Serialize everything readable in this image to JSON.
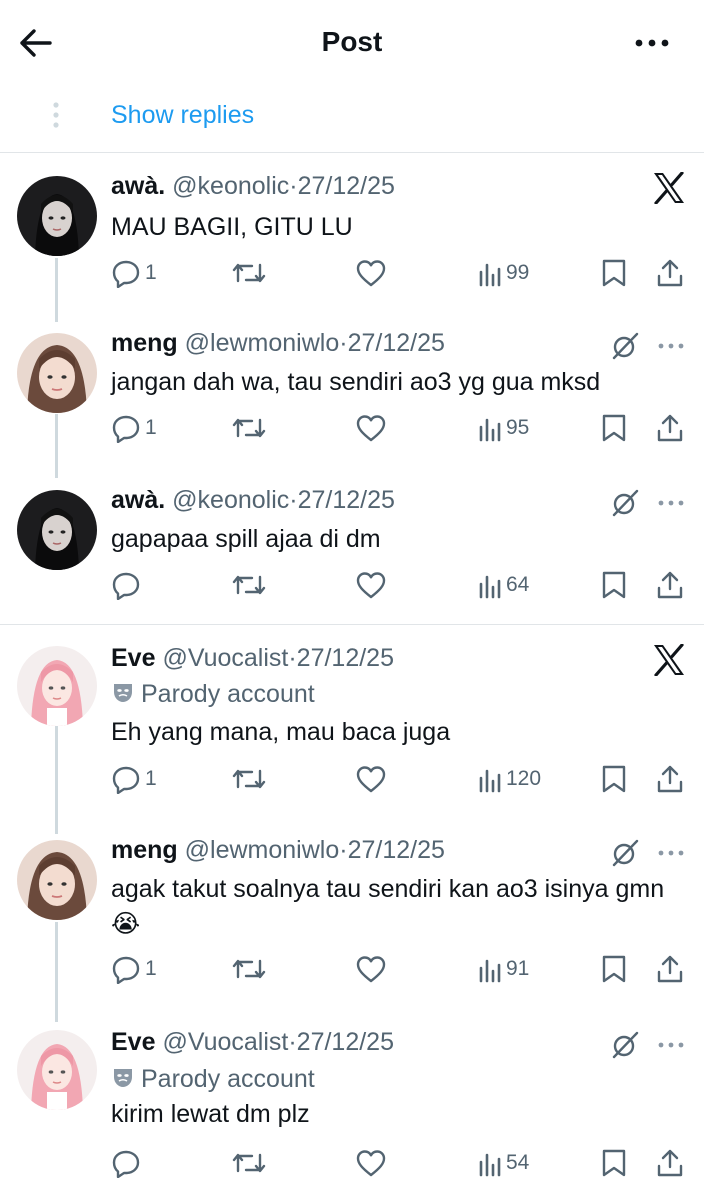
{
  "header": {
    "title": "Post"
  },
  "show_replies": {
    "label": "Show replies"
  },
  "tweets": [
    {
      "name": "awà.",
      "handle": "@keonolic",
      "date": "27/12/25",
      "parody": "",
      "text": "MAU BAGII, GITU LU",
      "replies": "1",
      "views": "99",
      "corner": "x-logo-icon"
    },
    {
      "name": "meng",
      "handle": "@lewmoniwlo",
      "date": "27/12/25",
      "parody": "",
      "text": "jangan dah wa, tau sendiri ao3 yg gua mksd",
      "replies": "1",
      "views": "95",
      "corner": "grok-icon"
    },
    {
      "name": "awà.",
      "handle": "@keonolic",
      "date": "27/12/25",
      "parody": "",
      "text": "gapapaa spill ajaa di dm",
      "replies": "",
      "views": "64",
      "corner": "grok-icon"
    },
    {
      "name": "Eve",
      "handle": "@Vuocalist",
      "date": "27/12/25",
      "parody": "Parody account",
      "text": "Eh yang mana, mau baca juga",
      "replies": "1",
      "views": "120",
      "corner": "x-logo-icon"
    },
    {
      "name": "meng",
      "handle": "@lewmoniwlo",
      "date": "27/12/25",
      "parody": "",
      "text": "agak takut soalnya tau sendiri kan ao3 isinya gmn 😭",
      "replies": "1",
      "views": "91",
      "corner": "grok-icon"
    },
    {
      "name": "Eve",
      "handle": "@Vuocalist",
      "date": "27/12/25",
      "parody": "Parody account",
      "text": "kirim lewat dm plz",
      "replies": "",
      "views": "54",
      "corner": "grok-icon"
    }
  ],
  "dot": "·",
  "colors": {
    "accent": "#1d9bf0",
    "text": "#0f1419",
    "muted": "#536471"
  }
}
